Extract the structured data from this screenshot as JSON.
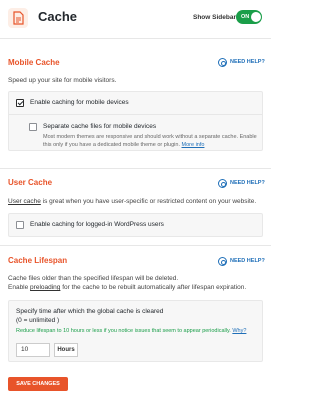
{
  "header": {
    "title": "Cache",
    "sidebar_label": "Show Sidebar",
    "sidebar_toggle": {
      "label": "ON",
      "on": true
    }
  },
  "sections": {
    "mobile": {
      "title": "Mobile Cache",
      "help": "NEED HELP?",
      "description": "Speed up your site for mobile visitors.",
      "enable_label": "Enable caching for mobile devices",
      "enable_checked": true,
      "separate_label": "Separate cache files for mobile devices",
      "separate_checked": false,
      "separate_desc": "Most modern themes are responsive and should work without a separate cache. Enable this only if you have a dedicated mobile theme or plugin.",
      "more_info": "More info"
    },
    "user": {
      "title": "User Cache",
      "help": "NEED HELP?",
      "link_text": "User cache",
      "description_rest": " is great when you have user-specific or restricted content on your website.",
      "enable_label": "Enable caching for logged-in WordPress users",
      "enable_checked": false
    },
    "lifespan": {
      "title": "Cache Lifespan",
      "help": "NEED HELP?",
      "desc_line1": "Cache files older than the specified lifespan will be deleted.",
      "desc_line2_pre": "Enable ",
      "desc_link": "preloading",
      "desc_line2_post": " for the cache to be rebuilt automatically after lifespan expiration.",
      "field_label_1": "Specify time after which the global cache is cleared",
      "field_label_2": "(0 = unlimited )",
      "tip": "Reduce lifespan to 10 hours or less if you notice issues that seem to appear periodically.",
      "tip_link": "Why?",
      "value": "10",
      "unit": "Hours"
    }
  },
  "actions": {
    "save_label": "SAVE CHANGES"
  },
  "colors": {
    "accent": "#e8542a",
    "link": "#1f6fb8",
    "toggle_on": "#1a9e49",
    "tip": "#1a9e49"
  }
}
